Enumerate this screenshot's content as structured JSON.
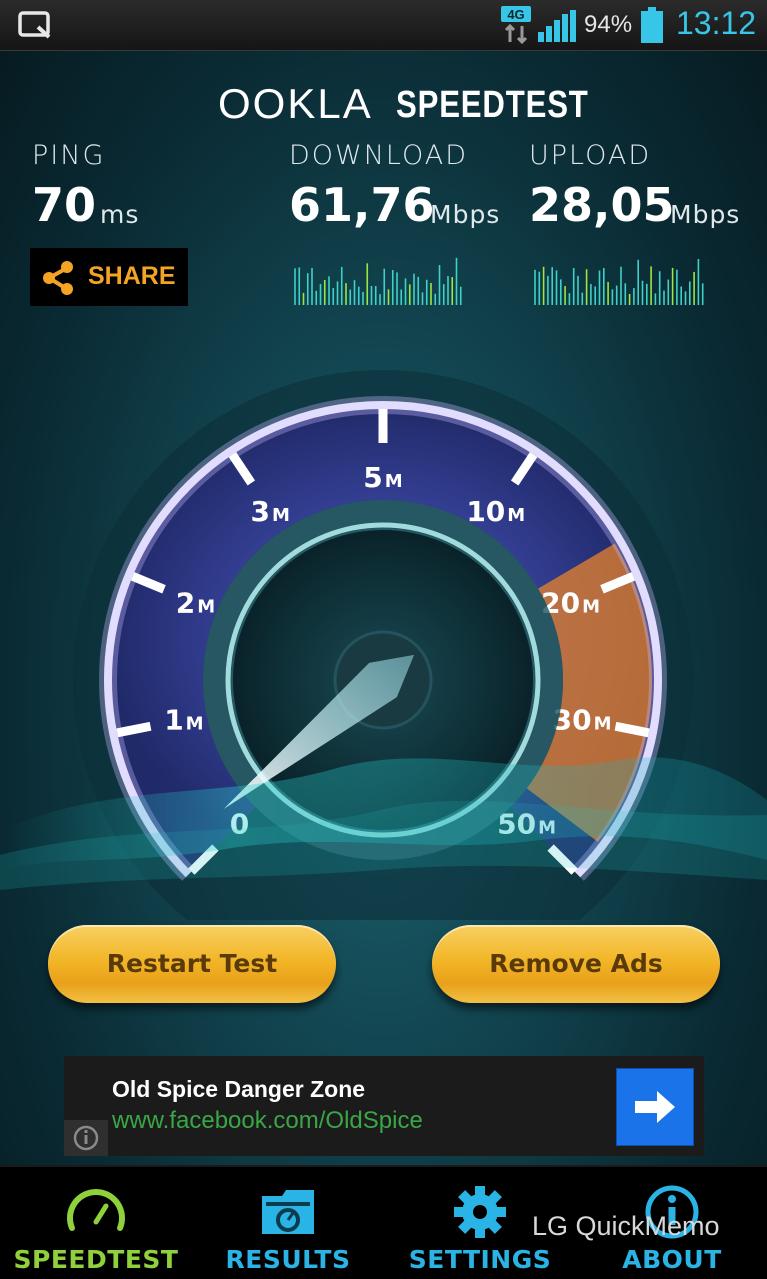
{
  "status_bar": {
    "network": "4G",
    "battery": "94%",
    "time": "13:12"
  },
  "header": {
    "brand": "OOKLA",
    "product": "SPEEDTEST"
  },
  "results": {
    "ping": {
      "label": "PING",
      "value": "70",
      "unit": "ms"
    },
    "download": {
      "label": "DOWNLOAD",
      "value": "61,76",
      "unit": "Mbps"
    },
    "upload": {
      "label": "UPLOAD",
      "value": "28,05",
      "unit": "Mbps"
    }
  },
  "share": {
    "label": "SHARE",
    "icon": "share-icon"
  },
  "gauge": {
    "ticks": [
      {
        "num": "0",
        "unit": ""
      },
      {
        "num": "1",
        "unit": "M"
      },
      {
        "num": "2",
        "unit": "M"
      },
      {
        "num": "3",
        "unit": "M"
      },
      {
        "num": "5",
        "unit": "M"
      },
      {
        "num": "10",
        "unit": "M"
      },
      {
        "num": "20",
        "unit": "M"
      },
      {
        "num": "30",
        "unit": "M"
      },
      {
        "num": "50",
        "unit": "M"
      }
    ],
    "needle_value": 0,
    "accent_color": "#e8832a",
    "dial_color": "#b39cf4"
  },
  "buttons": {
    "restart": "Restart Test",
    "remove_ads": "Remove Ads"
  },
  "ad": {
    "title": "Old Spice Danger Zone",
    "url": "www.facebook.com/OldSpice",
    "info_icon": "info-icon",
    "go_icon": "arrow-right-icon"
  },
  "nav": {
    "items": [
      {
        "label": "SPEEDTEST",
        "icon": "speedometer-icon",
        "color": "#8fd13a",
        "active": true
      },
      {
        "label": "RESULTS",
        "icon": "results-folder-icon",
        "color": "#2ab4e6",
        "active": false
      },
      {
        "label": "SETTINGS",
        "icon": "gear-icon",
        "color": "#2ab4e6",
        "active": false
      },
      {
        "label": "ABOUT",
        "icon": "info-icon",
        "color": "#2ab4e6",
        "active": false
      }
    ]
  },
  "overlay": {
    "quickmemo": "LG QuickMemo"
  }
}
